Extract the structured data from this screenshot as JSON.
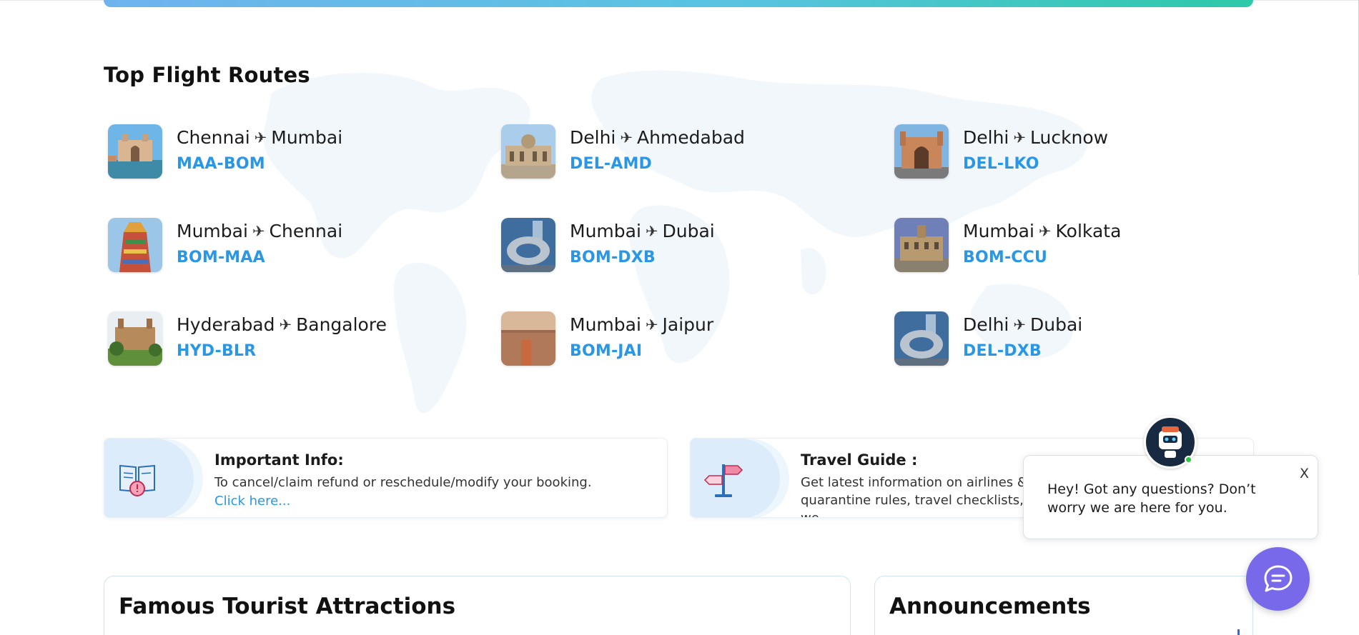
{
  "routes_section": {
    "title": "Top Flight Routes",
    "plane_glyph": "✈",
    "routes": [
      {
        "from": "Chennai",
        "to": "Mumbai",
        "code": "MAA-BOM",
        "image": "gateway-of-india-thumb"
      },
      {
        "from": "Delhi",
        "to": "Ahmedabad",
        "code": "DEL-AMD",
        "image": "ahmedabad-palace-thumb"
      },
      {
        "from": "Delhi",
        "to": "Lucknow",
        "code": "DEL-LKO",
        "image": "lucknow-gate-thumb"
      },
      {
        "from": "Mumbai",
        "to": "Chennai",
        "code": "BOM-MAA",
        "image": "chennai-temple-thumb"
      },
      {
        "from": "Mumbai",
        "to": "Dubai",
        "code": "BOM-DXB",
        "image": "dubai-future-museum-thumb"
      },
      {
        "from": "Mumbai",
        "to": "Kolkata",
        "code": "BOM-CCU",
        "image": "kolkata-building-thumb"
      },
      {
        "from": "Hyderabad",
        "to": "Bangalore",
        "code": "HYD-BLR",
        "image": "bangalore-palace-thumb"
      },
      {
        "from": "Mumbai",
        "to": "Jaipur",
        "code": "BOM-JAI",
        "image": "jaipur-city-thumb"
      },
      {
        "from": "Delhi",
        "to": "Dubai",
        "code": "DEL-DXB",
        "image": "dubai-future-museum-thumb"
      }
    ]
  },
  "info_cards": {
    "important": {
      "title": "Important Info:",
      "text": "To cancel/claim refund or reschedule/modify your booking.",
      "link": "Click here...",
      "icon": "book-alert-icon"
    },
    "guide": {
      "title": "Travel Guide :",
      "text": "Get latest information on airlines & ai quarantine rules, travel checklists, we",
      "icon": "signpost-icon"
    }
  },
  "panels": {
    "attractions_title": "Famous Tourist Attractions",
    "announcements_title": "Announcements"
  },
  "chat": {
    "message": "Hey! Got any questions? Don’t worry we are here for you.",
    "close_label": "X",
    "bot_icon": "robot-avatar-icon",
    "fab_icon": "chat-bubble-icon"
  },
  "colors": {
    "accent_blue": "#2a97e6",
    "chat_purple": "#7868ea",
    "gradient_start": "#6fb3ee",
    "gradient_end": "#2dc9a8"
  }
}
